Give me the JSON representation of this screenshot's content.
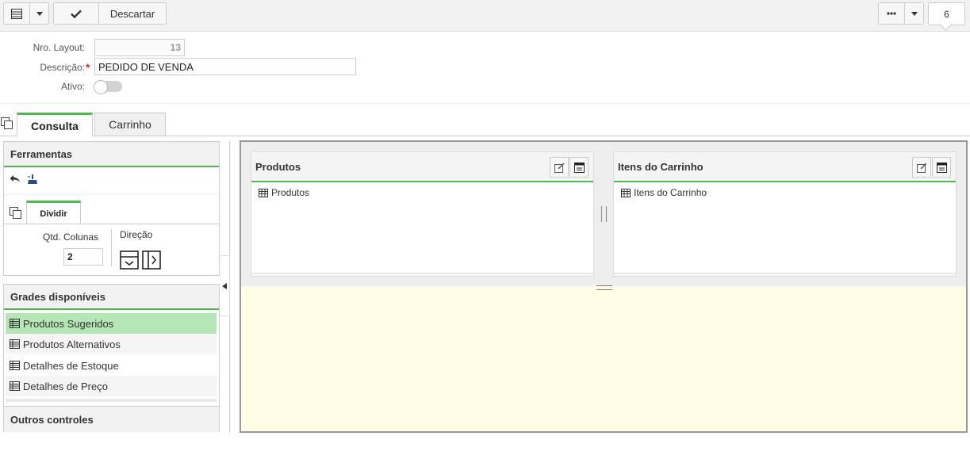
{
  "toolbar": {
    "discard_label": "Descartar",
    "counter": "6"
  },
  "form": {
    "layout_number_label": "Nro. Layout:",
    "layout_number_value": "13",
    "description_label": "Descrição:",
    "description_required_mark": "*",
    "description_value": "PEDIDO DE VENDA",
    "active_label": "Ativo:",
    "active_value": false
  },
  "tabs": [
    {
      "label": "Consulta",
      "active": true
    },
    {
      "label": "Carrinho",
      "active": false
    }
  ],
  "tools_panel": {
    "title": "Ferramentas",
    "subtab_label": "Dividir",
    "columns_label": "Qtd. Colunas",
    "columns_value": "2",
    "direction_label": "Direção"
  },
  "available_grids": {
    "title": "Grades disponíveis",
    "items": [
      {
        "label": "Produtos Sugeridos",
        "selected": true
      },
      {
        "label": "Produtos Alternativos",
        "selected": false
      },
      {
        "label": "Detalhes de Estoque",
        "selected": false
      },
      {
        "label": "Detalhes de Preço",
        "selected": false
      }
    ]
  },
  "other_controls": {
    "title": "Outros controles"
  },
  "canvas": {
    "panels": [
      {
        "title": "Produtos",
        "row_label": "Produtos"
      },
      {
        "title": "Itens do Carrinho",
        "row_label": "Itens do Carrinho"
      }
    ]
  },
  "colors": {
    "accent_green": "#4cba4c",
    "selected_row": "#b5e6b5",
    "canvas_bg": "#fefee6",
    "required_red": "#d9302c"
  },
  "icons": [
    "grid-menu-icon",
    "chevron-down-icon",
    "check-icon",
    "more-icon",
    "undo-icon",
    "clear-icon",
    "copy-icon",
    "direction-down-icon",
    "direction-right-icon",
    "table-icon",
    "edit-icon",
    "window-icon",
    "collapse-left-icon"
  ]
}
